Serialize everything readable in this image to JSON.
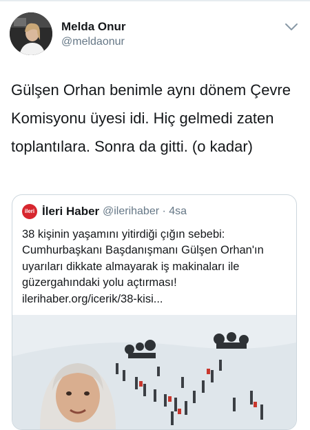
{
  "tweet": {
    "display_name": "Melda Onur",
    "handle": "@meldaonur",
    "text": "Gülşen Orhan benimle aynı dönem Çevre Komisyonu üyesi idi. Hiç gelmedi zaten toplantılara. Sonra da gitti. (o kadar)",
    "menu_icon": "chevron-down-icon"
  },
  "quoted_tweet": {
    "logo_text": "ileri",
    "display_name": "İleri Haber",
    "handle_time": "@ilerihaber · 4sa",
    "text": "38 kişinin yaşamını yitirdiği çığın sebebi: Cumhurbaşkanı Başdanışmanı Gülşen Orhan'ın uyarıları dikkate almayarak iş makinaları ile güzergahındaki yolu açtırması! ilerihaber.org/icerik/38-kisi..."
  },
  "colors": {
    "primary_text": "#14171a",
    "secondary_text": "#657786",
    "border": "#ccd6dd",
    "logo_red": "#d7262e"
  }
}
